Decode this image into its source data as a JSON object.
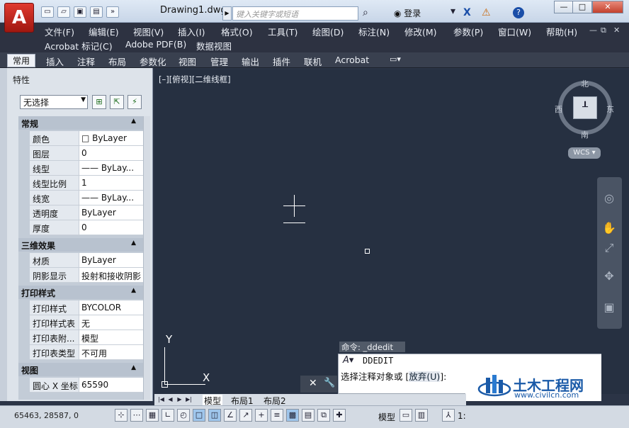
{
  "titlebar": {
    "document_title": "Drawing1.dwg",
    "search_placeholder": "键入关键字或短语",
    "login_label": "登录",
    "logo_letter": "A",
    "qa_icons": [
      "new-icon",
      "open-icon",
      "save-icon",
      "saveas-icon",
      "more-icon"
    ],
    "help_label": "?"
  },
  "menubar": {
    "row1": [
      "文件(F)",
      "编辑(E)",
      "视图(V)",
      "插入(I)",
      "格式(O)",
      "工具(T)",
      "绘图(D)",
      "标注(N)",
      "修改(M)",
      "参数(P)",
      "窗口(W)",
      "帮助(H)"
    ],
    "row2": [
      "Acrobat 标记(C)",
      "Adobe PDF(B)",
      "数据视图"
    ]
  },
  "ribbon": {
    "active_tab": "常用",
    "tabs": [
      "插入",
      "注释",
      "布局",
      "参数化",
      "视图",
      "管理",
      "输出",
      "插件",
      "联机",
      "Acrobat"
    ]
  },
  "palette": {
    "title": "特性",
    "selection": "无选择",
    "sections": [
      {
        "name": "常规",
        "rows": [
          {
            "label": "颜色",
            "value": "□ ByLayer"
          },
          {
            "label": "图层",
            "value": "0"
          },
          {
            "label": "线型",
            "value": "—— ByLay..."
          },
          {
            "label": "线型比例",
            "value": "1"
          },
          {
            "label": "线宽",
            "value": "—— ByLay..."
          },
          {
            "label": "透明度",
            "value": "ByLayer"
          },
          {
            "label": "厚度",
            "value": "0"
          }
        ]
      },
      {
        "name": "三维效果",
        "rows": [
          {
            "label": "材质",
            "value": "ByLayer"
          },
          {
            "label": "阴影显示",
            "value": "投射和接收阴影"
          }
        ]
      },
      {
        "name": "打印样式",
        "rows": [
          {
            "label": "打印样式",
            "value": "BYCOLOR"
          },
          {
            "label": "打印样式表",
            "value": "无"
          },
          {
            "label": "打印表附...",
            "value": "模型"
          },
          {
            "label": "打印表类型",
            "value": "不可用"
          }
        ]
      },
      {
        "name": "视图",
        "rows": [
          {
            "label": "圆心 X 坐标",
            "value": "65590"
          }
        ]
      }
    ]
  },
  "canvas": {
    "view_label": "[–][俯视][二维线框]",
    "compass": {
      "north": "北",
      "south": "南",
      "east": "东",
      "west": "西"
    },
    "wcs_label": "WCS",
    "ucs_y": "Y",
    "ucs_x": "X"
  },
  "command": {
    "history": "命令: _ddedit",
    "current": "DDEDIT",
    "prompt_text": "选择注释对象或 [",
    "prompt_option": "放弃(U)",
    "prompt_end": "]:"
  },
  "watermark": {
    "name": "土木工程网",
    "url": "www.civilcn.com"
  },
  "layout_tabs": [
    "模型",
    "布局1",
    "布局2"
  ],
  "statusbar": {
    "coords": "65463, 28587, 0",
    "model_label": "模型",
    "scale_label": "1:"
  }
}
